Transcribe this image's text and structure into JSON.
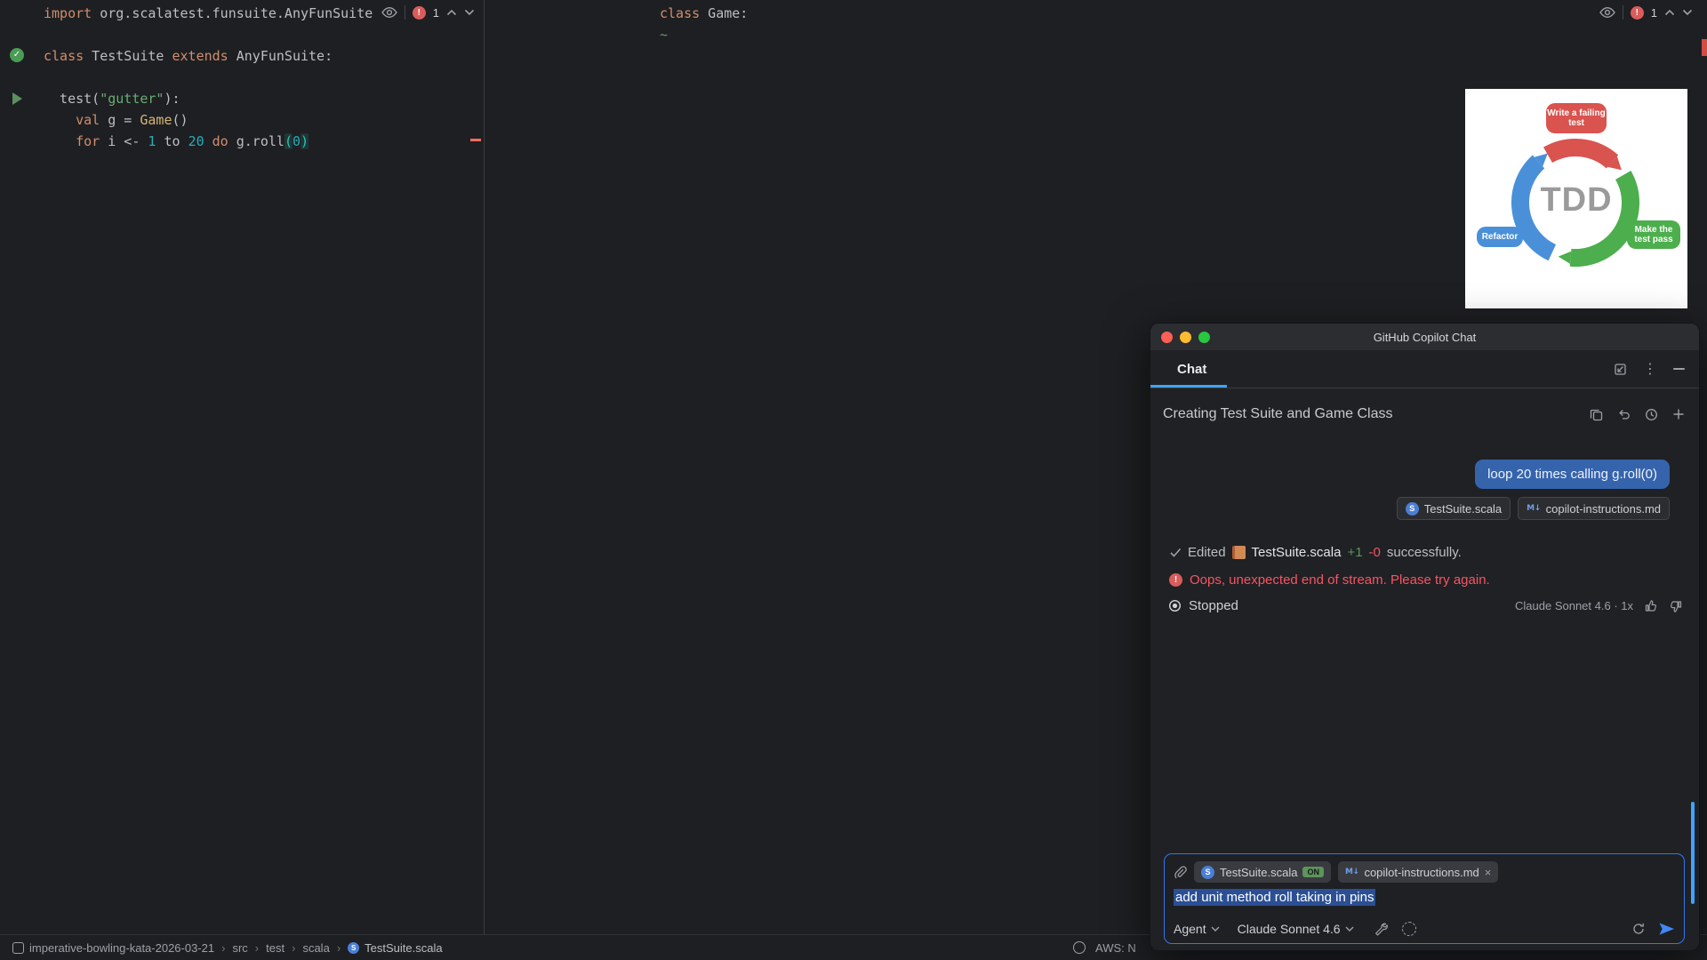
{
  "colors": {
    "accent_blue": "#3574f0",
    "tab_underline": "#3fa3ff",
    "error_red": "#f75464",
    "added_green": "#57965c",
    "user_bubble_blue": "#3564ad",
    "selection_blue": "#2b4f94",
    "tdd_red": "#d9534f",
    "tdd_green": "#4cae4c",
    "tdd_blue": "#4a90d9"
  },
  "glyphs": {
    "exclaim": "!",
    "check": "✓",
    "scala": "S",
    "markdown": "M↓",
    "kebab": "⋮"
  },
  "editor_left": {
    "inspection": {
      "error_count": "1"
    },
    "lines": [
      {
        "segments": [
          {
            "t": "import",
            "c": "kw"
          },
          {
            "t": " org.scalatest.funsuite.AnyFunSuite",
            "c": "plain"
          }
        ]
      },
      {
        "segments": []
      },
      {
        "segments": [
          {
            "t": "class",
            "c": "kw"
          },
          {
            "t": " TestSuite ",
            "c": "plain"
          },
          {
            "t": "extends",
            "c": "kw"
          },
          {
            "t": " AnyFunSuite:",
            "c": "plain"
          }
        ]
      },
      {
        "segments": []
      },
      {
        "segments": [
          {
            "t": "  test(",
            "c": "plain"
          },
          {
            "t": "\"gutter\"",
            "c": "str"
          },
          {
            "t": "):",
            "c": "plain"
          }
        ]
      },
      {
        "segments": [
          {
            "t": "    ",
            "c": "plain"
          },
          {
            "t": "val",
            "c": "kw"
          },
          {
            "t": " g = ",
            "c": "plain"
          },
          {
            "t": "Game",
            "c": "call"
          },
          {
            "t": "()",
            "c": "plain"
          }
        ]
      },
      {
        "segments": [
          {
            "t": "    ",
            "c": "plain"
          },
          {
            "t": "for",
            "c": "kw"
          },
          {
            "t": " i <- ",
            "c": "plain"
          },
          {
            "t": "1",
            "c": "num"
          },
          {
            "t": " to ",
            "c": "plain"
          },
          {
            "t": "20",
            "c": "num"
          },
          {
            "t": " ",
            "c": "plain"
          },
          {
            "t": "do",
            "c": "kw"
          },
          {
            "t": " g.roll",
            "c": "plain"
          },
          {
            "t": "(",
            "c": "brace"
          },
          {
            "t": "0",
            "c": "num"
          },
          {
            "t": ")",
            "c": "brace"
          }
        ]
      }
    ]
  },
  "editor_right": {
    "inspection": {
      "error_count": "1"
    },
    "lines": [
      {
        "segments": [
          {
            "t": "class",
            "c": "kw"
          },
          {
            "t": " Game:",
            "c": "plain"
          }
        ]
      },
      {
        "segments": [
          {
            "t": "~",
            "c": "tilde"
          }
        ]
      }
    ]
  },
  "tdd": {
    "center_label": "TDD",
    "labels": {
      "top": "Write a failing test",
      "right": "Make the test pass",
      "left": "Refactor"
    }
  },
  "copilot": {
    "title": "GitHub Copilot Chat",
    "tab_label": "Chat",
    "thread_title": "Creating Test Suite and Game Class",
    "user_message": "loop 20 times calling g.roll(0)",
    "message_attachments": [
      {
        "label": "TestSuite.scala"
      },
      {
        "label": "copilot-instructions.md"
      }
    ],
    "edited_row": {
      "verb": "Edited",
      "file": "TestSuite.scala",
      "added": "+1",
      "removed": "-0",
      "tail": "successfully."
    },
    "error_message": "Oops, unexpected end of stream. Please try again.",
    "status_label": "Stopped",
    "model_label": "Claude Sonnet 4.6 · 1x",
    "input": {
      "attachments": [
        {
          "label": "TestSuite.scala",
          "badge": "ON"
        },
        {
          "label": "copilot-instructions.md",
          "close": "×"
        }
      ],
      "text": "add unit method roll taking in pins",
      "mode_label": "Agent",
      "model_label": "Claude Sonnet 4.6"
    }
  },
  "statusbar": {
    "separator": "›",
    "crumbs": [
      "imperative-bowling-kata-2026-03-21",
      "src",
      "test",
      "scala",
      "TestSuite.scala"
    ],
    "right_text": "AWS: N"
  }
}
